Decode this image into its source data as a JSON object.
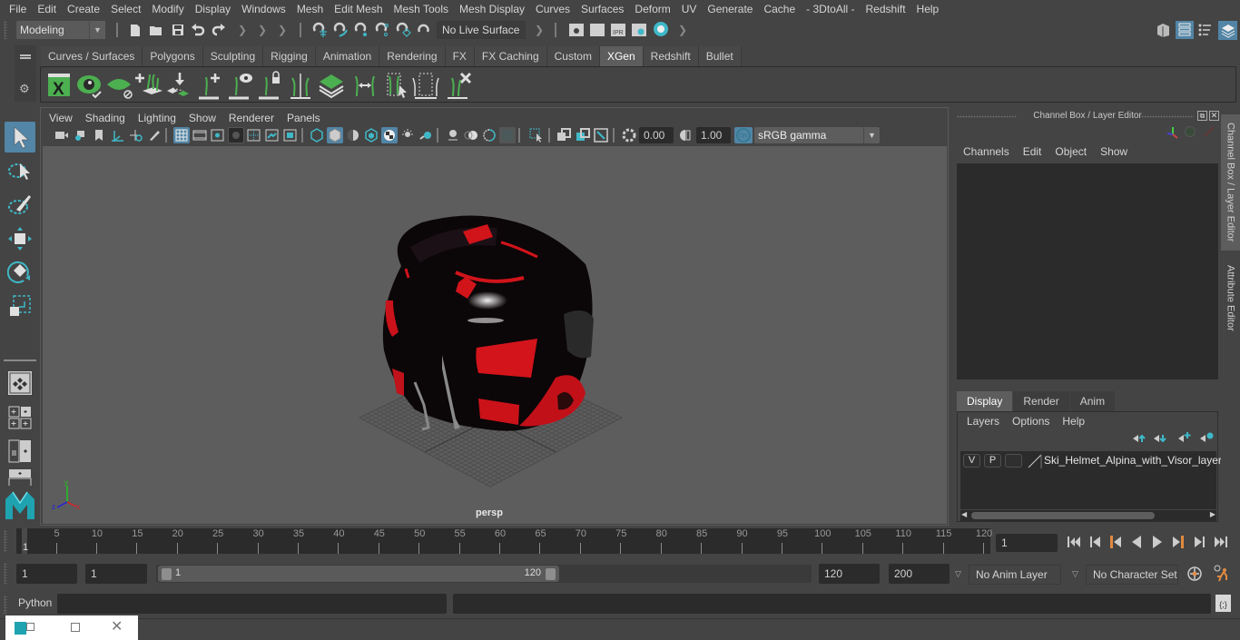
{
  "menubar": {
    "items": [
      "File",
      "Edit",
      "Create",
      "Select",
      "Modify",
      "Display",
      "Windows",
      "Mesh",
      "Edit Mesh",
      "Mesh Tools",
      "Mesh Display",
      "Curves",
      "Surfaces",
      "Deform",
      "UV",
      "Generate",
      "Cache",
      "- 3DtoAll -",
      "Redshift",
      "Help"
    ]
  },
  "statusline": {
    "mode": "Modeling",
    "live_surface": "No Live Surface",
    "icons": [
      "new-scene-icon",
      "open-scene-icon",
      "save-scene-icon",
      "undo-icon",
      "redo-icon",
      "select-by-hierarchy-icon",
      "snap-to-grid-icon",
      "snap-to-curve-icon",
      "snap-to-point-icon",
      "snap-to-view-plane-icon",
      "make-live-icon",
      "render-view-icon",
      "render-current-frame-icon",
      "ipr-render-icon",
      "render-settings-icon",
      "hypershade-icon"
    ]
  },
  "shelf": {
    "tabs": [
      "Curves / Surfaces",
      "Polygons",
      "Sculpting",
      "Rigging",
      "Animation",
      "Rendering",
      "FX",
      "FX Caching",
      "Custom",
      "XGen",
      "Redshift",
      "Bullet"
    ],
    "active_tab": "XGen",
    "icons": [
      "xgen-editor-icon",
      "xgen-preview-icon",
      "xgen-clear-preview-icon",
      "xgen-add-guides-icon",
      "xgen-place-guides-icon",
      "xgen-add-guide-icon",
      "xgen-show-guides-icon",
      "xgen-lock-guides-icon",
      "xgen-sculpt-guides-icon",
      "xgen-layer-icon",
      "xgen-rebuild-icon",
      "xgen-select-icon",
      "xgen-bounds-icon",
      "xgen-delete-icon"
    ]
  },
  "viewport": {
    "menu": [
      "View",
      "Shading",
      "Lighting",
      "Show",
      "Renderer",
      "Panels"
    ],
    "exposure": "0.00",
    "gamma": "1.00",
    "color_mgmt": "ON",
    "color_space": "sRGB gamma",
    "camera": "persp",
    "axis": {
      "x": "x",
      "y": "y",
      "z": "z"
    }
  },
  "channel_box": {
    "title": "Channel Box / Layer Editor",
    "menu": [
      "Channels",
      "Edit",
      "Object",
      "Show"
    ],
    "layer_tabs": [
      "Display",
      "Render",
      "Anim"
    ],
    "active_layer_tab": "Display",
    "layer_menu": [
      "Layers",
      "Options",
      "Help"
    ],
    "layers": [
      {
        "visible": "V",
        "playback": "P",
        "type": "",
        "name": "Ski_Helmet_Alpina_with_Visor_layer"
      }
    ]
  },
  "side_tabs": [
    "Channel Box / Layer Editor",
    "Attribute Editor"
  ],
  "timeline": {
    "ticks": [
      5,
      10,
      15,
      20,
      25,
      30,
      35,
      40,
      45,
      50,
      55,
      60,
      65,
      70,
      75,
      80,
      85,
      90,
      95,
      100,
      105,
      110,
      115,
      120
    ],
    "start": 1,
    "end": 120,
    "current_frame": "1",
    "current_frame_field": "1"
  },
  "range": {
    "start_field": "1",
    "playback_start_field": "1",
    "range_start_label": "1",
    "range_end_label": "120",
    "playback_end_field": "120",
    "end_field": "200",
    "anim_layer": "No Anim Layer",
    "character_set": "No Character Set"
  },
  "command_line": {
    "language": "Python",
    "input": "",
    "output": ""
  },
  "colors": {
    "accent": "#5285a6",
    "xgen_green": "#4caf50",
    "helmet_red": "#d0141a",
    "teal": "#3fb8c8",
    "key_orange": "#e08a40"
  }
}
